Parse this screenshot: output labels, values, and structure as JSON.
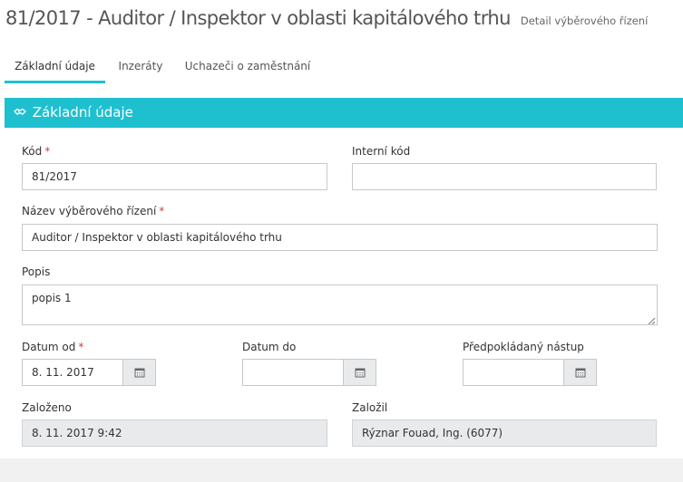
{
  "header": {
    "title": "81/2017 - Auditor / Inspektor v oblasti kapitálového trhu",
    "subtitle": "Detail výběrového řízení"
  },
  "tabs": [
    {
      "label": "Základní údaje",
      "active": true
    },
    {
      "label": "Inzeráty",
      "active": false
    },
    {
      "label": "Uchazeči o zaměstnání",
      "active": false
    }
  ],
  "panel": {
    "title": "Základní údaje",
    "accent_color": "#1ec0cf",
    "icon": "handshake-icon"
  },
  "form": {
    "kod": {
      "label": "Kód",
      "required_mark": "*",
      "value": "81/2017"
    },
    "interni_kod": {
      "label": "Interní kód",
      "value": ""
    },
    "nazev": {
      "label": "Název výběrového řízení",
      "required_mark": "*",
      "value": "Auditor / Inspektor v oblasti kapitálového trhu"
    },
    "popis": {
      "label": "Popis",
      "value": "popis 1"
    },
    "datum_od": {
      "label": "Datum od",
      "required_mark": "*",
      "value": "8. 11. 2017",
      "icon": "calendar-icon"
    },
    "datum_do": {
      "label": "Datum do",
      "value": "",
      "icon": "calendar-icon"
    },
    "nastup": {
      "label": "Předpokládaný nástup",
      "value": "",
      "icon": "calendar-icon"
    },
    "zalozeno": {
      "label": "Založeno",
      "value": "8. 11. 2017 9:42"
    },
    "zalozil": {
      "label": "Založil",
      "value": "Rýznar Fouad, Ing. (6077)"
    }
  }
}
